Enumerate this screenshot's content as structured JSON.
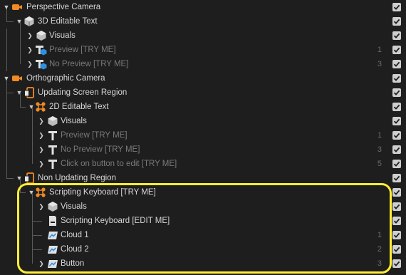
{
  "rows": [
    {
      "id": "r0",
      "label": "Perspective Camera",
      "count": "",
      "dim": false,
      "icon": "camera-icon",
      "chev": "down"
    },
    {
      "id": "r1",
      "label": "3D Editable Text",
      "count": "",
      "dim": false,
      "icon": "cube-icon",
      "chev": "down"
    },
    {
      "id": "r2",
      "label": "Visuals",
      "count": "",
      "dim": false,
      "icon": "visuals-icon",
      "chev": "right"
    },
    {
      "id": "r3",
      "label": "Preview [TRY ME]",
      "count": "1",
      "dim": true,
      "icon": "text-3d-icon",
      "chev": "right"
    },
    {
      "id": "r4",
      "label": "No Preview [TRY ME]",
      "count": "3",
      "dim": true,
      "icon": "text-3d-icon",
      "chev": "right"
    },
    {
      "id": "r5",
      "label": "Orthographic Camera",
      "count": "",
      "dim": false,
      "icon": "camera-icon",
      "chev": "down"
    },
    {
      "id": "r6",
      "label": "Updating Screen Region",
      "count": "",
      "dim": false,
      "icon": "screen-region-icon",
      "chev": "down"
    },
    {
      "id": "r7",
      "label": "2D Editable Text",
      "count": "",
      "dim": false,
      "icon": "transform-icon",
      "chev": "down"
    },
    {
      "id": "r8",
      "label": "Visuals",
      "count": "",
      "dim": false,
      "icon": "visuals-icon",
      "chev": "right"
    },
    {
      "id": "r9",
      "label": "Preview [TRY ME]",
      "count": "1",
      "dim": true,
      "icon": "text-icon",
      "chev": "right"
    },
    {
      "id": "r10",
      "label": "No Preview [TRY ME]",
      "count": "3",
      "dim": true,
      "icon": "text-icon",
      "chev": "right"
    },
    {
      "id": "r11",
      "label": "Click on button to edit [TRY ME]",
      "count": "5",
      "dim": true,
      "icon": "text-icon",
      "chev": "right"
    },
    {
      "id": "r12",
      "label": "Non Updating Region",
      "count": "",
      "dim": false,
      "icon": "screen-region-icon",
      "chev": "down"
    },
    {
      "id": "r13",
      "label": "Scripting Keyboard [TRY ME]",
      "count": "",
      "dim": false,
      "icon": "transform-icon",
      "chev": "down"
    },
    {
      "id": "r14",
      "label": "Visuals",
      "count": "",
      "dim": false,
      "icon": "visuals-icon",
      "chev": "right"
    },
    {
      "id": "r15",
      "label": "Scripting Keyboard [EDIT ME]",
      "count": "",
      "dim": false,
      "icon": "script-icon",
      "chev": ""
    },
    {
      "id": "r16",
      "label": "Cloud 1",
      "count": "1",
      "dim": false,
      "icon": "image-icon",
      "chev": ""
    },
    {
      "id": "r17",
      "label": "Cloud 2",
      "count": "2",
      "dim": false,
      "icon": "image-icon",
      "chev": ""
    },
    {
      "id": "r18",
      "label": "Button",
      "count": "3",
      "dim": false,
      "icon": "image-icon",
      "chev": "right"
    }
  ],
  "colors": {
    "accent_orange": "#f08a24",
    "accent_blue": "#2f8fe0",
    "highlight": "#ffee32"
  }
}
